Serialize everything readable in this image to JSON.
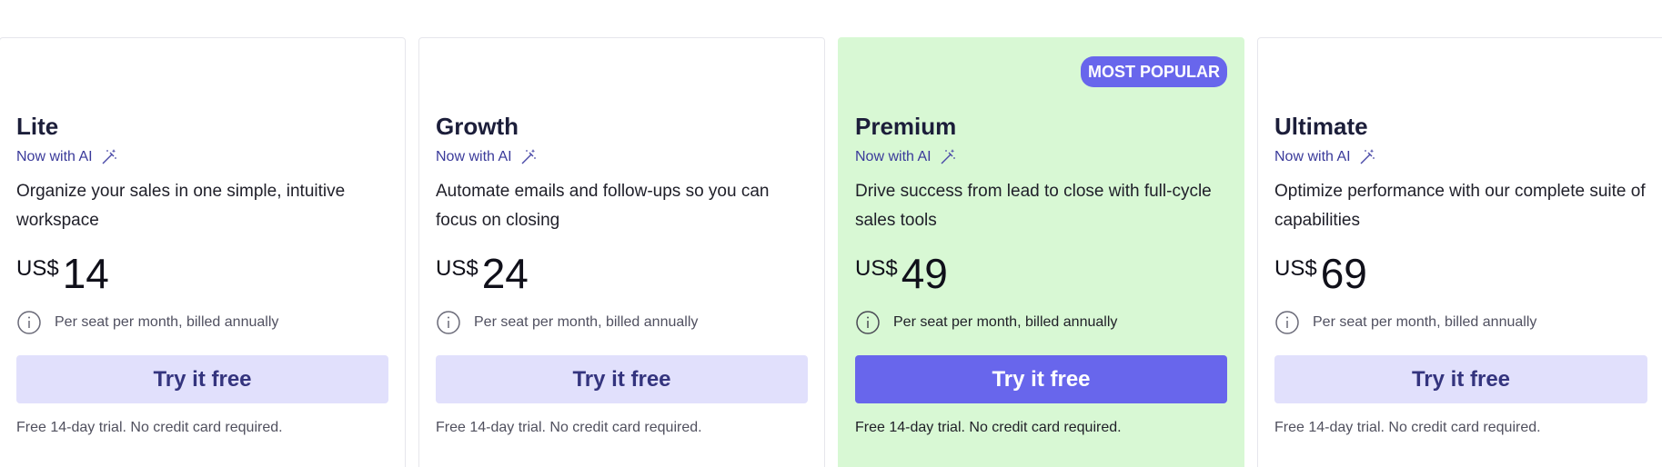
{
  "plans": [
    {
      "name": "Lite",
      "ai_label": "Now with AI",
      "description": "Organize your sales in one simple, intuitive workspace",
      "currency": "US$",
      "price": "14",
      "billing": "Per seat per month, billed annually",
      "cta": "Try it free",
      "note": "Free 14-day trial. No credit card required."
    },
    {
      "name": "Growth",
      "ai_label": "Now with AI",
      "description": "Automate emails and follow-ups so you can focus on closing",
      "currency": "US$",
      "price": "24",
      "billing": "Per seat per month, billed annually",
      "cta": "Try it free",
      "note": "Free 14-day trial. No credit card required."
    },
    {
      "name": "Premium",
      "badge": "MOST POPULAR",
      "ai_label": "Now with AI",
      "description": "Drive success from lead to close with full-cycle sales tools",
      "currency": "US$",
      "price": "49",
      "billing": "Per seat per month, billed annually",
      "cta": "Try it free",
      "note": "Free 14-day trial. No credit card required."
    },
    {
      "name": "Ultimate",
      "ai_label": "Now with AI",
      "description": "Optimize performance with our complete suite of capabilities",
      "currency": "US$",
      "price": "69",
      "billing": "Per seat per month, billed annually",
      "cta": "Try it free",
      "note": "Free 14-day trial. No credit card required."
    }
  ],
  "colors": {
    "accent": "#6866ec",
    "cta_light": "#e1e0fc",
    "popular_bg": "#d8f8d4"
  },
  "icons": [
    "magic-wand-icon",
    "info-icon"
  ]
}
